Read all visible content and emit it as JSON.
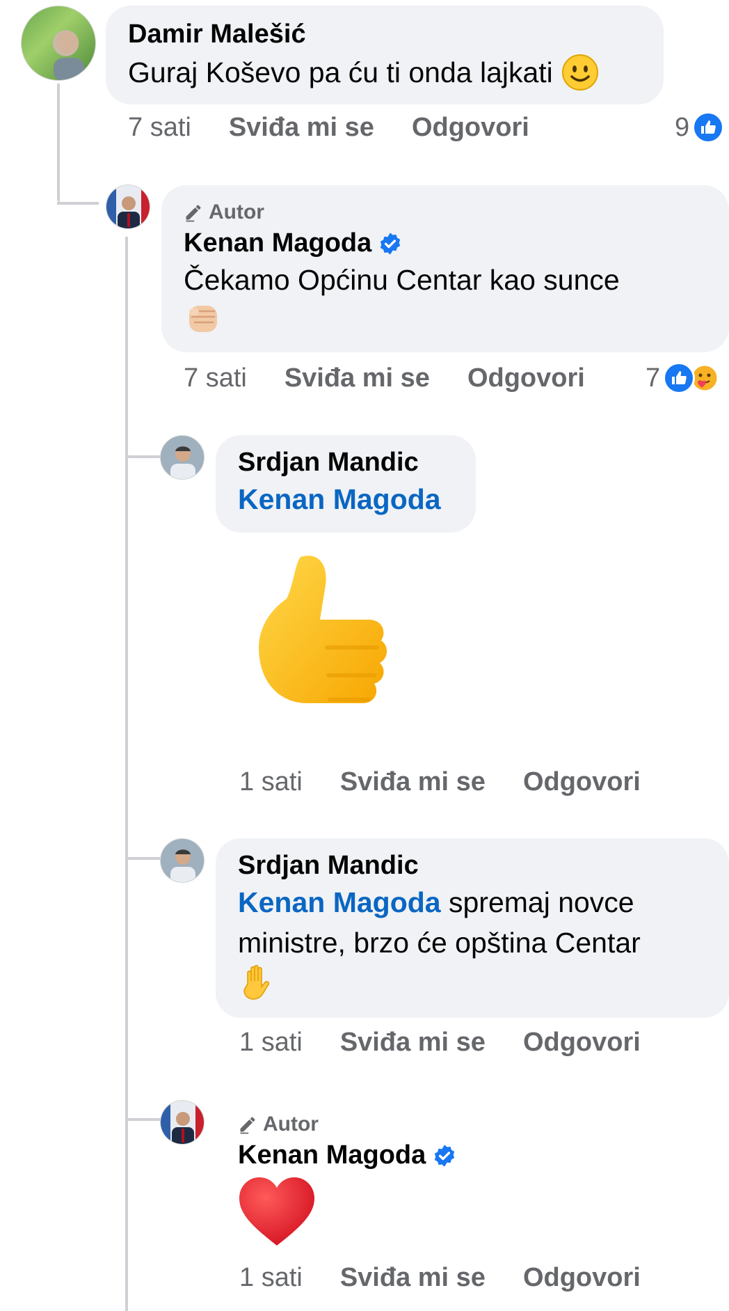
{
  "comments": [
    {
      "author": "Damir Malešić",
      "text": "Guraj Koševo pa ću ti onda lajkati",
      "time": "7 sati",
      "like_label": "Sviđa mi se",
      "reply_label": "Odgovori",
      "reaction_count": "9"
    },
    {
      "author_tag": "Autor",
      "author": "Kenan Magoda",
      "text": "Čekamo Općinu Centar kao sunce",
      "time": "7 sati",
      "like_label": "Sviđa mi se",
      "reply_label": "Odgovori",
      "reaction_count": "7"
    },
    {
      "author": "Srdjan Mandic",
      "mention": "Kenan Magoda",
      "time": "1 sati",
      "like_label": "Sviđa mi se",
      "reply_label": "Odgovori"
    },
    {
      "author": "Srdjan Mandic",
      "mention": "Kenan Magoda",
      "text_line1": " spremaj novce",
      "text_line2": "ministre, brzo će opština Centar",
      "time": "1 sati",
      "like_label": "Sviđa mi se",
      "reply_label": "Odgovori"
    },
    {
      "author_tag": "Autor",
      "author": "Kenan Magoda",
      "time": "1 sati",
      "like_label": "Sviđa mi se",
      "reply_label": "Odgovori"
    }
  ],
  "colors": {
    "accent": "#1877f2",
    "link": "#0a66c2",
    "bubble": "#f0f2f5",
    "meta": "#65676b"
  },
  "icons": [
    "slightly-smiling-face-emoji",
    "fist-emoji",
    "thumbs-up-sticker",
    "raised-hand-emoji",
    "red-heart-emoji",
    "like-reaction-icon",
    "care-reaction-icon",
    "verified-badge-icon",
    "pencil-icon"
  ]
}
